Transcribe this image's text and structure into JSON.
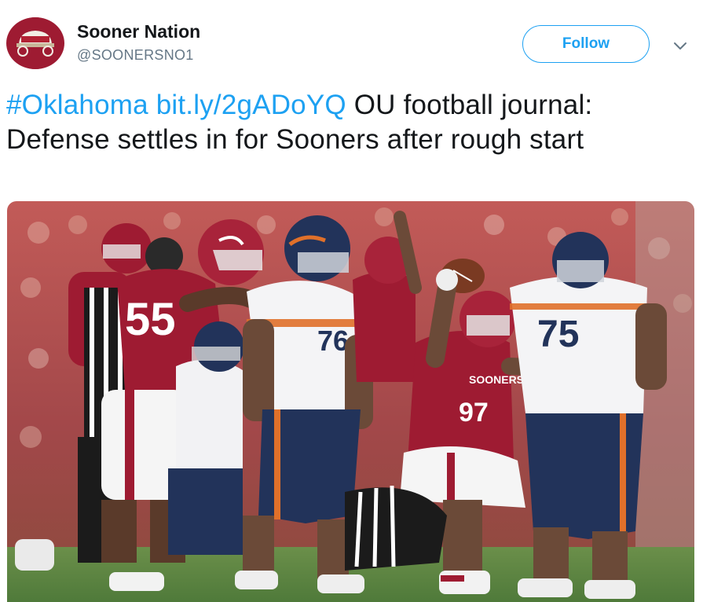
{
  "account": {
    "display_name": "Sooner Nation",
    "handle": "@SOONERSNO1",
    "avatar_icon": "schooner-wagon-logo",
    "avatar_color": "#9e1b32"
  },
  "actions": {
    "follow_label": "Follow",
    "menu_icon": "chevron-down-icon"
  },
  "tweet": {
    "hashtag": "#Oklahoma",
    "link": "bit.ly/2gADoYQ",
    "text": "OU football journal: Defense settles in for Sooners after rough start"
  },
  "photo": {
    "jersey_left": "55",
    "jersey_center": "76",
    "jersey_right": "75",
    "jersey_sooner": "97",
    "sooner_chest": "SOONERS",
    "colors": {
      "crimson": "#9e1b32",
      "navy": "#22335a",
      "orange": "#e0702a",
      "field": "#4f7a3a"
    }
  },
  "colors": {
    "link_blue": "#1da1f2",
    "text": "#14171a",
    "muted": "#657786"
  }
}
